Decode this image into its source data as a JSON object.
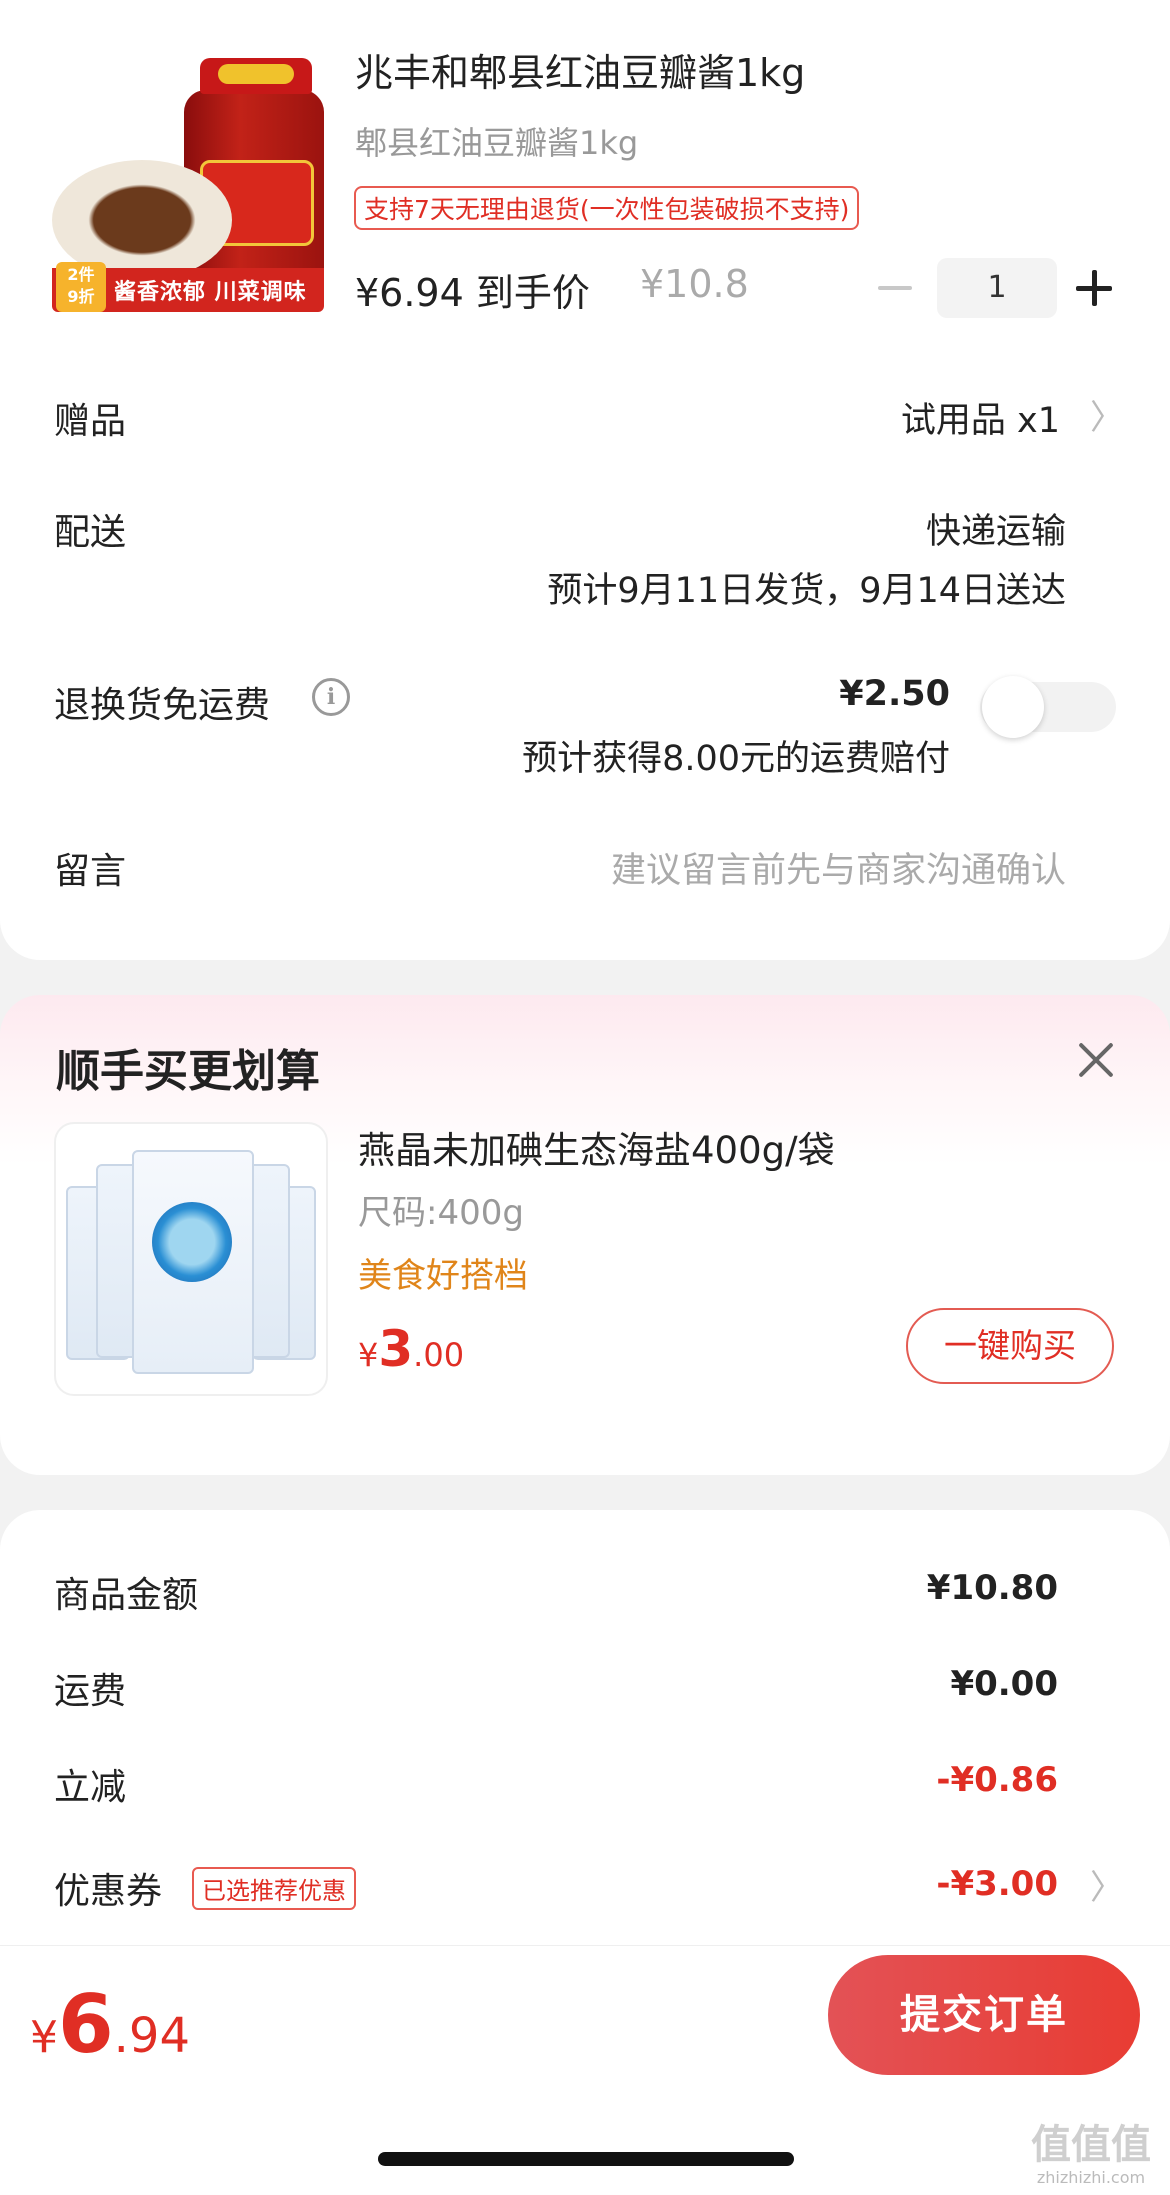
{
  "product": {
    "title": "兆丰和郫县红油豆瓣酱1kg",
    "spec": "郫县红油豆瓣酱1kg",
    "return_tag": "支持7天无理由退货(一次性包装破损不支持)",
    "final_price_label": "¥6.94 到手价",
    "original_price": "¥10.8",
    "quantity": "1",
    "image": {
      "badge": "2件\n9折",
      "slogan": "酱香浓郁 川菜调味"
    }
  },
  "rows": {
    "gift": {
      "label": "赠品",
      "value": "试用品 x1"
    },
    "delivery": {
      "label": "配送",
      "method": "快递运输",
      "estimate": "预计9月11日发货，9月14日送达"
    },
    "return_shipping": {
      "label": "退换货免运费",
      "price": "¥2.50",
      "note": "预计获得8.00元的运费赔付",
      "enabled": false
    },
    "message": {
      "label": "留言",
      "placeholder": "建议留言前先与商家沟通确认"
    }
  },
  "addon": {
    "title": "顺手买更划算",
    "item": {
      "title": "燕晶未加碘生态海盐400g/袋",
      "size": "尺码:400g",
      "tag": "美食好搭档",
      "price_symbol": "¥",
      "price_int": "3",
      "price_dec": ".00",
      "button": "一键购买"
    }
  },
  "summary": {
    "goods_amount": {
      "label": "商品金额",
      "value": "¥10.80"
    },
    "shipping": {
      "label": "运费",
      "value": "¥0.00"
    },
    "discount": {
      "label": "立减",
      "value": "-¥0.86"
    },
    "coupon": {
      "label": "优惠券",
      "tag": "已选推荐优惠",
      "value": "-¥3.00"
    }
  },
  "footer": {
    "total_symbol": "¥",
    "total_int": "6",
    "total_dec": ".94",
    "submit": "提交订单"
  },
  "watermark": {
    "main": "值值值",
    "sub": "zhizhizhi.com"
  },
  "colors": {
    "accent": "#e02e24",
    "tag_orange": "#e0851a",
    "muted": "#999999"
  }
}
